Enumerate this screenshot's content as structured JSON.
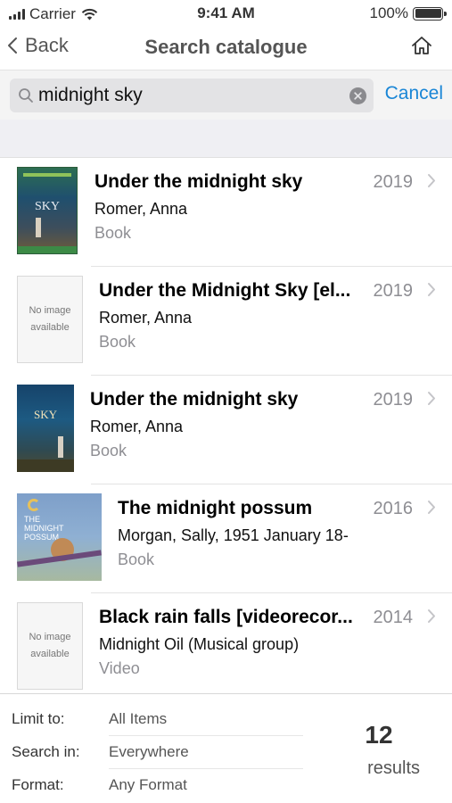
{
  "status_bar": {
    "carrier": "Carrier",
    "time": "9:41 AM",
    "battery": "100%"
  },
  "nav": {
    "back_label": "Back",
    "title": "Search catalogue",
    "home_icon": "home-icon"
  },
  "search": {
    "query": "midnight sky",
    "cancel_label": "Cancel"
  },
  "results": [
    {
      "title": "Under the midnight sky",
      "author": "Romer, Anna",
      "type": "Book",
      "year": "2019",
      "cover": "cover-image",
      "cover_text": "SKY"
    },
    {
      "title": "Under the Midnight Sky [el...",
      "author": "Romer, Anna",
      "type": "Book",
      "year": "2019",
      "cover": "no-image",
      "cover_text": "No image available"
    },
    {
      "title": "Under the midnight sky",
      "author": "Romer, Anna",
      "type": "Book",
      "year": "2019",
      "cover": "cover-image",
      "cover_text": "SKY"
    },
    {
      "title": "The midnight possum",
      "author": "Morgan, Sally, 1951 January 18-",
      "type": "Book",
      "year": "2016",
      "cover": "cover-image",
      "cover_text": "THE MIDNIGHT POSSUM"
    },
    {
      "title": "Black rain falls [videorecor...",
      "author": "Midnight Oil (Musical group)",
      "type": "Video",
      "year": "2014",
      "cover": "no-image",
      "cover_text": "No image available"
    }
  ],
  "footer": {
    "limit_label": "Limit to:",
    "limit_value": "All Items",
    "search_in_label": "Search in:",
    "search_in_value": "Everywhere",
    "format_label": "Format:",
    "format_value": "Any Format",
    "count": "12",
    "count_label": "results"
  },
  "colors": {
    "accent": "#1a86d6",
    "secondary_text": "#8e8e93",
    "separator": "#e3e3e3"
  }
}
